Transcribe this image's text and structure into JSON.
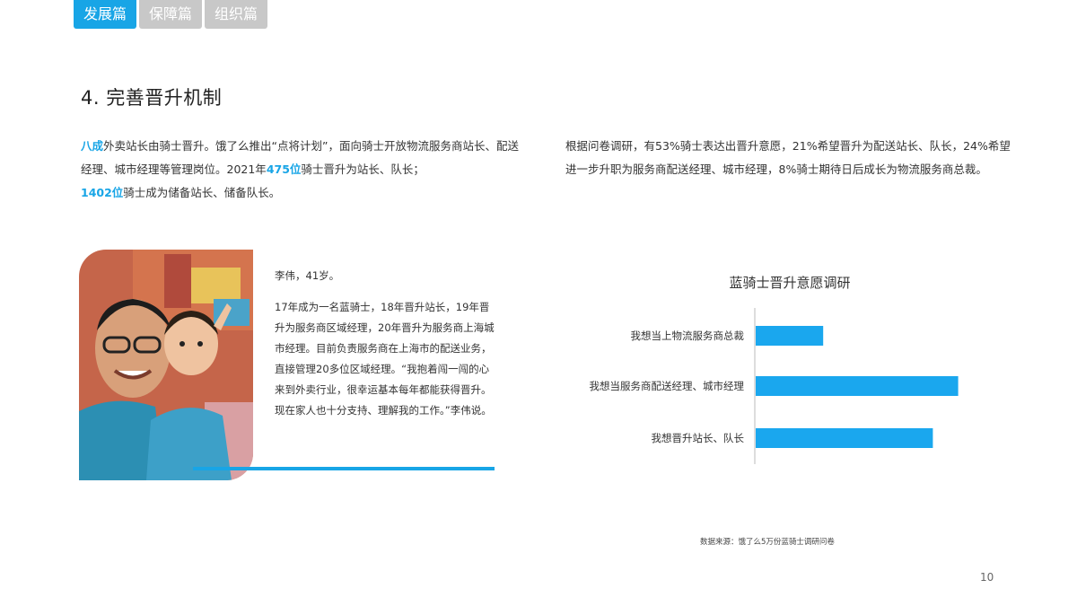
{
  "tabs": [
    {
      "label": "发展篇",
      "active": true
    },
    {
      "label": "保障篇",
      "active": false
    },
    {
      "label": "组织篇",
      "active": false
    }
  ],
  "section_title": "4. 完善晋升机制",
  "left_paragraph": {
    "p1_hl": "八成",
    "p1": "外卖站长由骑士晋升。饿了么推出“点将计划”，面向骑士开放物流服务商站长、配送经理、城市经理等管理岗位。2021年",
    "p2_hl": "475位",
    "p2": "骑士晋升为站长、队长；",
    "p3_hl": "1402位",
    "p3": "骑士成为储备站长、储备队长。"
  },
  "right_paragraph": "根据问卷调研，有53%骑士表达出晋升意愿，21%希望晋升为配送站长、队长，24%希望进一步升职为服务商配送经理、城市经理，8%骑士期待日后成长为物流服务商总裁。",
  "profile": {
    "name_line": "李伟，41岁。",
    "story": "17年成为一名蓝骑士，18年晋升站长，19年晋升为服务商区域经理，20年晋升为服务商上海城市经理。目前负责服务商在上海市的配送业务，直接管理20多位区域经理。“我抱着闯一闯的心来到外卖行业，很幸运基本每年都能获得晋升。现在家人也十分支持、理解我的工作。”李伟说。"
  },
  "chart_data": {
    "type": "bar",
    "orientation": "horizontal",
    "title": "蓝骑士晋升意愿调研",
    "categories": [
      "我想当上物流服务商总裁",
      "我想当服务商配送经理、城市经理",
      "我想晋升站长、队长"
    ],
    "values": [
      8,
      24,
      21
    ],
    "unit": "%",
    "color": "#1aa7ee",
    "xlabel": "",
    "ylabel": "",
    "xlim": [
      0,
      25
    ],
    "grid": false,
    "legend": "none"
  },
  "source": "数据来源：饿了么5万份蓝骑士调研问卷",
  "page_number": "10"
}
